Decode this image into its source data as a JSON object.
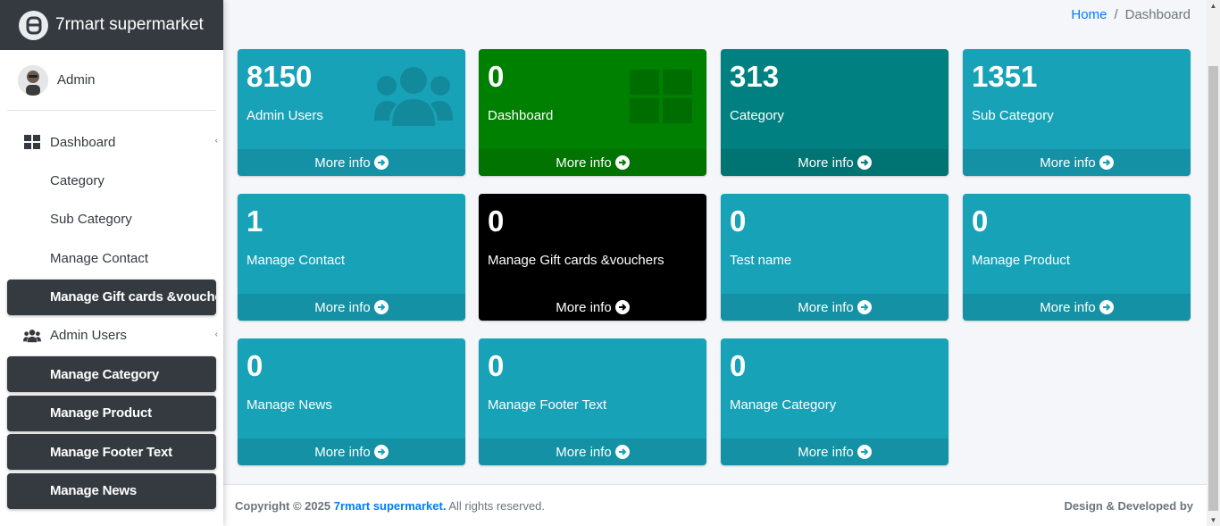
{
  "brand": {
    "name": "7rmart supermarket"
  },
  "user": {
    "name": "Admin"
  },
  "sidebar": {
    "items": [
      {
        "label": "Dashboard",
        "icon": "dashboard-grid-icon"
      },
      {
        "label": "Category"
      },
      {
        "label": "Sub Category"
      },
      {
        "label": "Manage Contact"
      },
      {
        "label": "Manage Gift cards &vouchers",
        "active": true
      },
      {
        "label": "Admin Users",
        "icon": "users-icon"
      },
      {
        "label": "Manage Category",
        "active": true
      },
      {
        "label": "Manage Product",
        "active": true
      },
      {
        "label": "Manage Footer Text",
        "active": true
      },
      {
        "label": "Manage News",
        "active": true
      }
    ]
  },
  "breadcrumb": {
    "home": "Home",
    "separator": "/",
    "current": "Dashboard"
  },
  "boxes": [
    {
      "number": "8150",
      "label": "Admin Users",
      "footer": "More info",
      "color": "#17a2b8"
    },
    {
      "number": "0",
      "label": "Dashboard",
      "footer": "More info",
      "color": "#008000"
    },
    {
      "number": "313",
      "label": "Category",
      "footer": "More info",
      "color": "#008080"
    },
    {
      "number": "1351",
      "label": "Sub Category",
      "footer": "More info",
      "color": "#17a2b8"
    },
    {
      "number": "1",
      "label": "Manage Contact",
      "footer": "More info",
      "color": "#17a2b8"
    },
    {
      "number": "0",
      "label": "Manage Gift cards &vouchers",
      "footer": "More info",
      "color": "#000000"
    },
    {
      "number": "0",
      "label": "Test name",
      "footer": "More info",
      "color": "#17a2b8"
    },
    {
      "number": "0",
      "label": "Manage Product",
      "footer": "More info",
      "color": "#17a2b8"
    },
    {
      "number": "0",
      "label": "Manage News",
      "footer": "More info",
      "color": "#17a2b8"
    },
    {
      "number": "0",
      "label": "Manage Footer Text",
      "footer": "More info",
      "color": "#17a2b8"
    },
    {
      "number": "0",
      "label": "Manage Category",
      "footer": "More info",
      "color": "#17a2b8"
    }
  ],
  "footer": {
    "copyright": "Copyright © 2025",
    "brand_link": "7rmart supermarket.",
    "rights": "All rights reserved.",
    "right_text": "Design & Developed by"
  }
}
